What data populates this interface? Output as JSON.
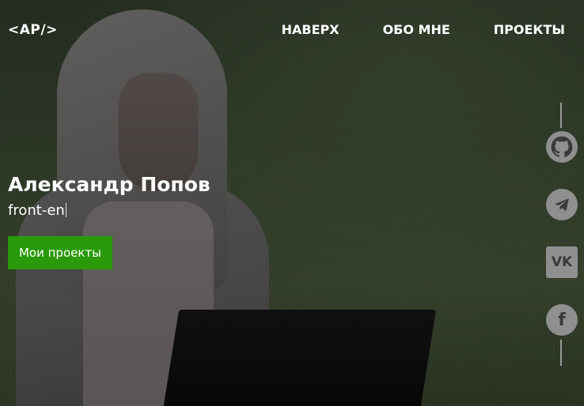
{
  "header": {
    "logo": "<AP/>",
    "nav": [
      {
        "label": "НАВЕРХ"
      },
      {
        "label": "ОБО МНЕ"
      },
      {
        "label": "ПРОЕКТЫ"
      }
    ]
  },
  "intro": {
    "name": "Александр Попов",
    "role_typed": "front-en",
    "button_label": "Мои проекты"
  },
  "social": [
    {
      "icon": "github-icon"
    },
    {
      "icon": "telegram-icon"
    },
    {
      "icon": "vk-icon",
      "glyph": "VK"
    },
    {
      "icon": "facebook-icon",
      "glyph": "f"
    }
  ],
  "colors": {
    "accent": "#2a9a0b",
    "social_bg": "#8f8f8f"
  }
}
